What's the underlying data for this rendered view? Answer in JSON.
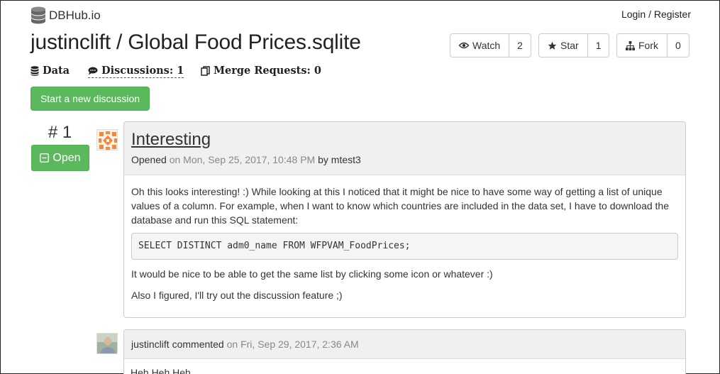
{
  "header": {
    "brand": "DBHub.io",
    "login": "Login / Register"
  },
  "repo": {
    "title": "justinclift / Global Food Prices.sqlite",
    "watch_label": "Watch",
    "watch_count": "2",
    "star_label": "Star",
    "star_count": "1",
    "fork_label": "Fork",
    "fork_count": "0"
  },
  "nav": {
    "data": "Data",
    "discussions": "Discussions: 1",
    "merge_requests": "Merge Requests: 0"
  },
  "actions": {
    "start_discussion": "Start a new discussion"
  },
  "discussion": {
    "number": "# 1",
    "status": "Open",
    "title": "Interesting",
    "opened_label": "Opened",
    "opened_date": "on Mon, Sep 25, 2017, 10:48 PM",
    "by_label": "by",
    "author": "mtest3",
    "body_p1": "Oh this looks interesting! :) While looking at this I noticed that it might be nice to have some way of getting a list of unique values of a column. For example, when I want to know which countries are included in the data set, I have to download the database and run this SQL statement:",
    "code": "SELECT DISTINCT adm0_name FROM WFPVAM_FoodPrices;",
    "body_p2": "It would be nice to be able to get the same list by clicking some icon or whatever :)",
    "body_p3": "Also I figured, I'll try out the discussion feature ;)"
  },
  "comment": {
    "author": "justinclift",
    "action": "commented",
    "date": "on Fri, Sep 29, 2017, 2:36 AM",
    "body": "Heh Heh Heh"
  },
  "colors": {
    "success": "#5cb85c",
    "panel_header": "#f0f0f0",
    "border": "#cccccc",
    "muted": "#888888"
  },
  "icons": {
    "brand": "database-icon",
    "watch": "eye-icon",
    "star": "star-icon",
    "fork": "sitemap-icon",
    "data": "database-icon",
    "discussions": "comment-icon",
    "merge": "copy-icon",
    "open": "minus-square-icon"
  }
}
